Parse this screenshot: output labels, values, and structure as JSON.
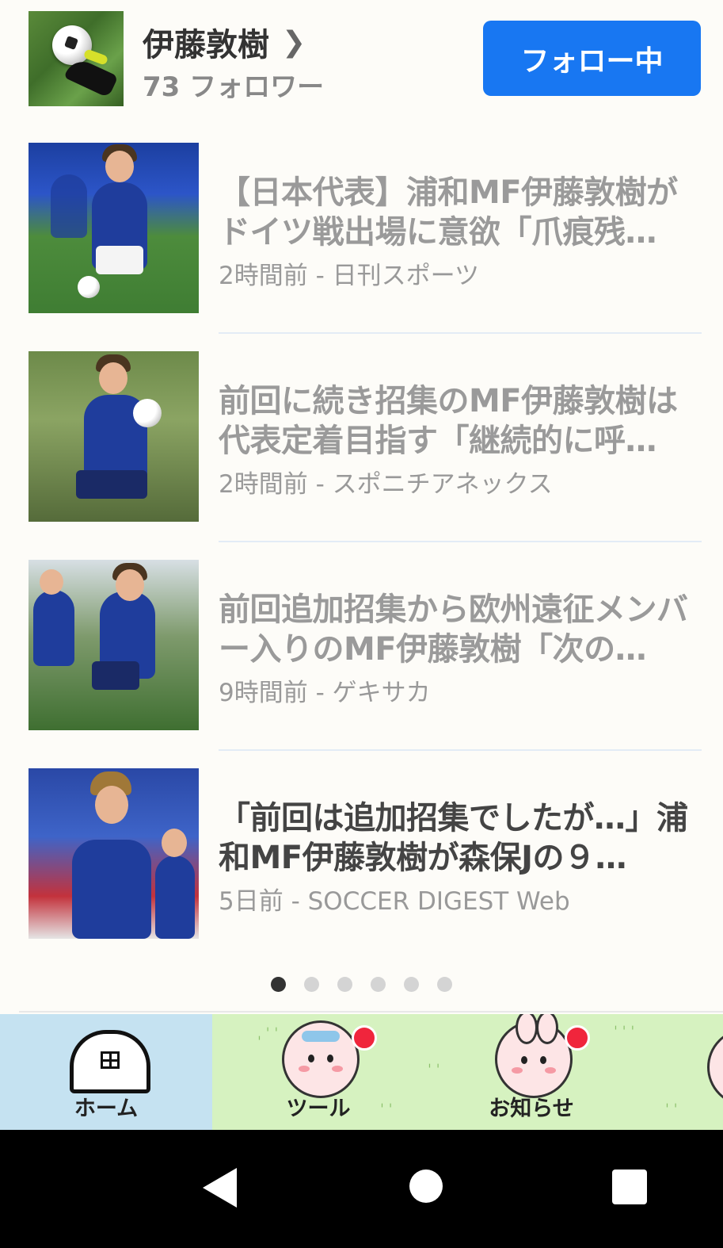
{
  "topic": {
    "name": "伊藤敦樹",
    "followers": "73 フォロワー",
    "follow_button": "フォロー中"
  },
  "articles": [
    {
      "headline": "【日本代表】浦和MF伊藤敦樹がドイツ戦出場に意欲「爪痕残…",
      "meta": "2時間前 - 日刊スポーツ",
      "read": true
    },
    {
      "headline": "前回に続き招集のMF伊藤敦樹は代表定着目指す「継続的に呼…",
      "meta": "2時間前 - スポニチアネックス",
      "read": true
    },
    {
      "headline": "前回追加招集から欧州遠征メンバー入りのMF伊藤敦樹「次の…",
      "meta": "9時間前 - ゲキサカ",
      "read": true
    },
    {
      "headline": "「前回は追加招集でしたが…」浦和MF伊藤敦樹が森保Jの９…",
      "meta": "5日前 - SOCCER DIGEST Web",
      "read": false
    }
  ],
  "pager": {
    "total": 6,
    "active": 1
  },
  "tabbar": {
    "home": "ホーム",
    "tools": "ツール",
    "news": "お知らせ"
  },
  "colors": {
    "accent": "#1877f2",
    "tab_bg": "#d6f2c0",
    "home_tab_bg": "#c5e2f1",
    "badge": "#f0253c"
  }
}
